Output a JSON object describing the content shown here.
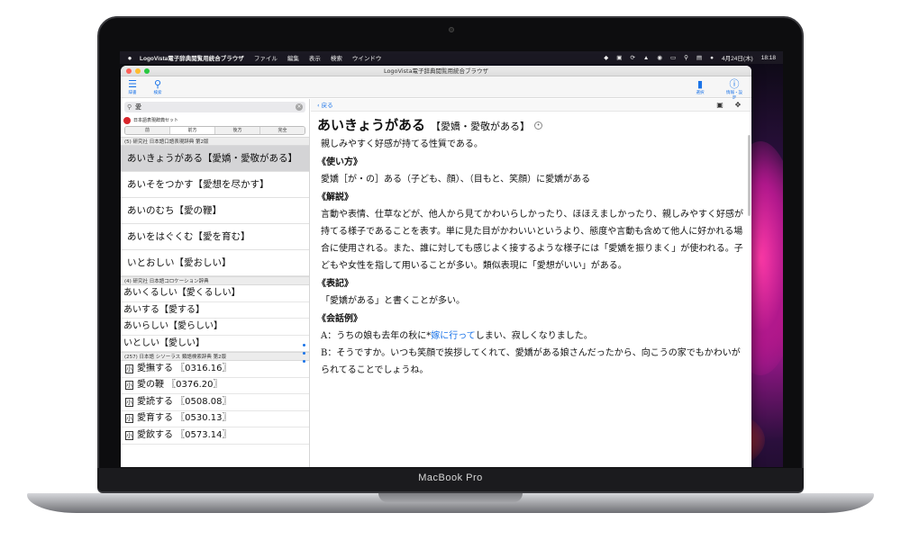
{
  "menubar": {
    "app": "LogoVista電子辞典閲覧用統合ブラウザ",
    "menus": [
      "ファイル",
      "編集",
      "表示",
      "検索",
      "ウインドウ"
    ],
    "date": "4月24日(木)",
    "time": "18:18"
  },
  "window": {
    "title": "LogoVista電子辞典閲覧用統合ブラウザ"
  },
  "toolbar": {
    "list_label": "辞書",
    "search_label": "検索",
    "select_label": "選択",
    "info_label": "情報・設定"
  },
  "sidebar": {
    "search_value": "愛",
    "dict_set": "日本語表現辞典セット",
    "modes": [
      "前方",
      "後方",
      "完全"
    ],
    "mode_first": "前",
    "groups": [
      {
        "title": "(5) 研究社 日本語口語表現辞典 第2版",
        "items": [
          "あいきょうがある【愛嬌・愛敬がある】",
          "あいそをつかす【愛想を尽かす】",
          "あいのむち【愛の鞭】",
          "あいをはぐくむ【愛を育む】",
          "いとおしい【愛おしい】"
        ]
      },
      {
        "title": "(4) 研究社 日本語コロケーション辞典",
        "items": [
          "あいくるしい【愛くるしい】",
          "あいする【愛する】",
          "あいらしい【愛らしい】",
          "いとしい【愛しい】"
        ]
      },
      {
        "title": "(257) 日本語 シソーラス 類語検索辞典 第2版",
        "badge": "小",
        "items": [
          "愛撫する 〖0316.16〗",
          "愛の鞭 〖0376.20〗",
          "愛読する 〖0508.08〗",
          "愛育する 〖0530.13〗",
          "愛飲する 〖0573.14〗"
        ]
      }
    ]
  },
  "content": {
    "back_label": "戻る",
    "headword": "あいきょうがある",
    "headword_kanji": "【愛嬌・愛敬がある】",
    "definition": "親しみやすく好感が持てる性質である。",
    "usage_title": "《使い方》",
    "usage": "愛嬌［が・の］ある（子ども、顔）、（目もと、笑顔）に愛嬌がある",
    "explain_title": "《解説》",
    "explain": "言動や表情、仕草などが、他人から見てかわいらしかったり、ほほえましかったり、親しみやすく好感が持てる様子であることを表す。単に見た目がかわいいというより、態度や言動も含めて他人に好かれる場合に使用される。また、誰に対しても感じよく接するような様子には「愛嬌を振りまく」が使われる。子どもや女性を指して用いることが多い。類似表現に「愛想がいい」がある。",
    "notation_title": "《表記》",
    "notation": "「愛嬌がある」と書くことが多い。",
    "dialog_title": "《会話例》",
    "dialog_a_prefix": "A：うちの娘も去年の秋に*",
    "dialog_a_link": "嫁に行って",
    "dialog_a_suffix": "しまい、寂しくなりました。",
    "dialog_b": "B：そうですか。いつも笑顔で挨拶してくれて、愛嬌がある娘さんだったから、向こうの家でもかわいがられてることでしょうね。"
  },
  "device": {
    "brand": "MacBook Pro"
  }
}
